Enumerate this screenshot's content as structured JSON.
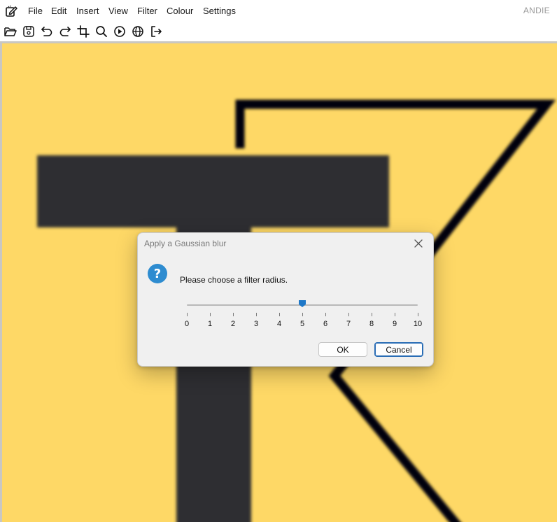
{
  "app": {
    "title": "ANDIE"
  },
  "menu": {
    "items": [
      {
        "label": "File"
      },
      {
        "label": "Edit"
      },
      {
        "label": "Insert"
      },
      {
        "label": "View"
      },
      {
        "label": "Filter"
      },
      {
        "label": "Colour"
      },
      {
        "label": "Settings"
      }
    ]
  },
  "toolbar": {
    "tools": [
      {
        "icon": "open-folder-icon"
      },
      {
        "icon": "save-icon"
      },
      {
        "icon": "undo-icon"
      },
      {
        "icon": "redo-icon"
      },
      {
        "icon": "crop-icon"
      },
      {
        "icon": "zoom-icon"
      },
      {
        "icon": "record-icon"
      },
      {
        "icon": "globe-icon"
      },
      {
        "icon": "exit-icon"
      }
    ]
  },
  "canvas": {
    "background_color": "#FED866",
    "shapes_color": "#2E2D31",
    "stroke_color": "#050510"
  },
  "dialog": {
    "title": "Apply a Gaussian blur",
    "prompt": "Please choose a filter radius.",
    "slider": {
      "min": 0,
      "max": 10,
      "value": 5,
      "tick_labels": [
        "0",
        "1",
        "2",
        "3",
        "4",
        "5",
        "6",
        "7",
        "8",
        "9",
        "10"
      ]
    },
    "ok_label": "OK",
    "cancel_label": "Cancel",
    "accent_color": "#1E78C8"
  }
}
